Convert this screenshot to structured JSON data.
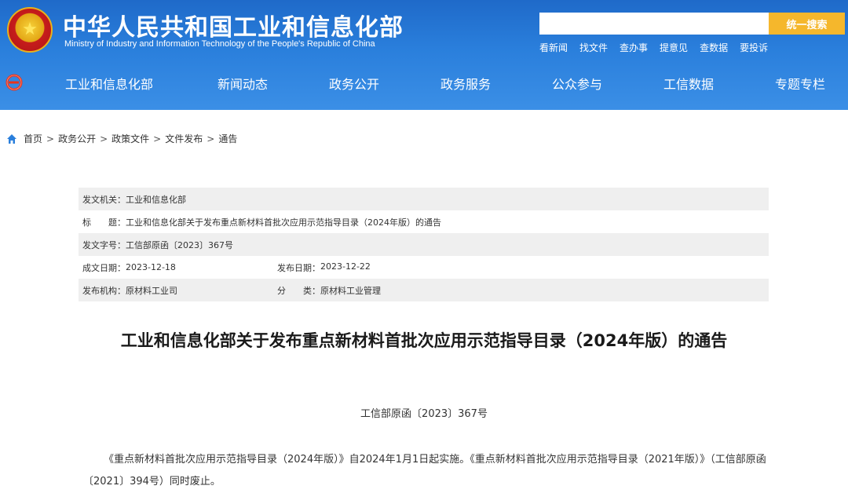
{
  "header": {
    "site_title": "中华人民共和国工业和信息化部",
    "site_subtitle": "Ministry of Industry and Information Technology of the People's Republic of China",
    "search_placeholder": "",
    "search_button": "统一搜索",
    "quick_links": [
      "看新闻",
      "找文件",
      "查办事",
      "提意见",
      "查数据",
      "要投诉"
    ]
  },
  "nav": {
    "items": [
      "工业和信息化部",
      "新闻动态",
      "政务公开",
      "政务服务",
      "公众参与",
      "工信数据",
      "专题专栏"
    ]
  },
  "breadcrumb": [
    "首页",
    "政务公开",
    "政策文件",
    "文件发布",
    "通告"
  ],
  "meta": {
    "issuer_label": "发文机关：",
    "issuer": "工业和信息化部",
    "title_label": "标　　题：",
    "title": "工业和信息化部关于发布重点新材料首批次应用示范指导目录（2024年版）的通告",
    "doc_no_label": "发文字号：",
    "doc_no": "工信部原函〔2023〕367号",
    "created_label": "成文日期：",
    "created": "2023-12-18",
    "published_label": "发布日期：",
    "published": "2023-12-22",
    "org_label": "发布机构：",
    "org": "原材料工业司",
    "category_label": "分　　类：",
    "category": "原材料工业管理"
  },
  "document": {
    "title": "工业和信息化部关于发布重点新材料首批次应用示范指导目录（2024年版）的通告",
    "number": "工信部原函〔2023〕367号",
    "paragraph": "《重点新材料首批次应用示范指导目录（2024年版）》自2024年1月1日起实施。《重点新材料首批次应用示范指导目录（2021年版）》（工信部原函〔2021〕394号）同时废止。"
  },
  "colors": {
    "header_blue": "#2a7fdc",
    "search_button": "#f5b72c",
    "meta_shade": "#efefef"
  }
}
